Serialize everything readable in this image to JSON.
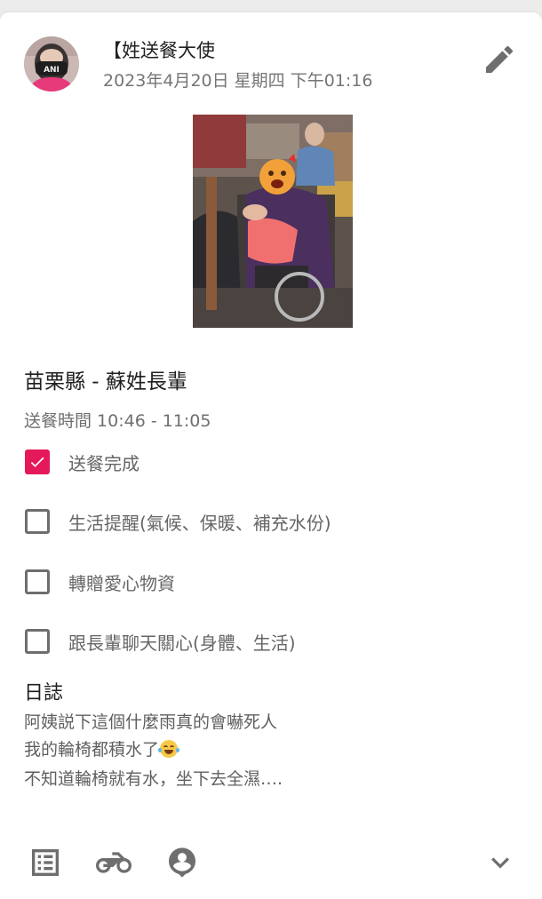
{
  "post": {
    "author": "【姓送餐大使",
    "date": "2023年4月20日 星期四 下午01:16"
  },
  "meal": {
    "location": "苗栗縣 - 蘇姓長輩",
    "time": "送餐時間 10:46 - 11:05"
  },
  "tasks": [
    {
      "label": "送餐完成",
      "checked": true
    },
    {
      "label": "生活提醒(氣候、保暖、補充水份)",
      "checked": false
    },
    {
      "label": "轉贈愛心物資",
      "checked": false
    },
    {
      "label": "跟長輩聊天關心(身體、生活)",
      "checked": false
    }
  ],
  "log": {
    "title": "日誌",
    "lines": [
      "阿姨説下這個什麼雨真的會嚇死人",
      "我的輪椅都積水了",
      "不知道輪椅就有水，坐下去全濕…."
    ]
  },
  "icons": {
    "edit": "edit-pencil-icon",
    "list": "list-icon",
    "motorcycle": "motorcycle-icon",
    "person": "person-pin-icon",
    "expand": "chevron-down-icon"
  },
  "colors": {
    "accent": "#e5195a",
    "icon_gray": "#6e6e6e"
  }
}
